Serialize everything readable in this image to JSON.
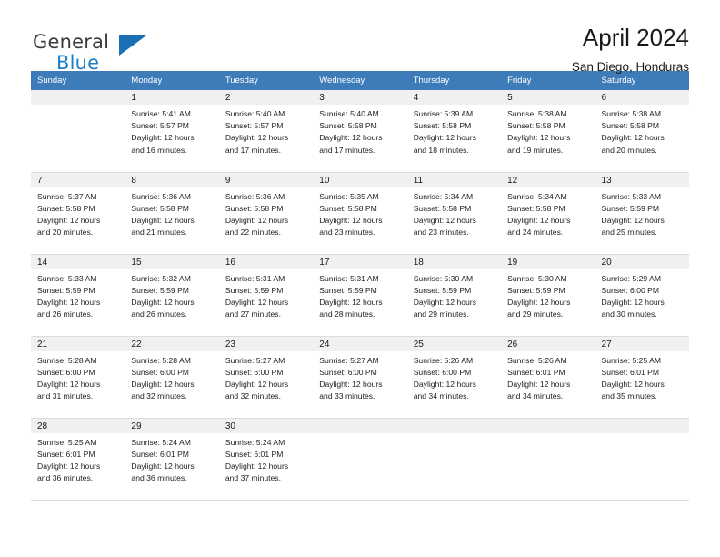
{
  "brand": {
    "word1": "General",
    "word2": "Blue",
    "triangle_color": "#1b6fb4",
    "blue_color": "#1b7fc4"
  },
  "header": {
    "title": "April 2024",
    "location": "San Diego, Honduras"
  },
  "theme": {
    "header_row_bg": "#3d7cb9",
    "daynum_bg": "#f0f0f0",
    "grid_line": "#dcdcdc"
  },
  "weekdays": [
    "Sunday",
    "Monday",
    "Tuesday",
    "Wednesday",
    "Thursday",
    "Friday",
    "Saturday"
  ],
  "labels": {
    "sunrise": "Sunrise:",
    "sunset": "Sunset:",
    "daylight": "Daylight:"
  },
  "weeks": [
    [
      {
        "day": ""
      },
      {
        "day": "1",
        "sunrise": "Sunrise: 5:41 AM",
        "sunset": "Sunset: 5:57 PM",
        "daylight1": "Daylight: 12 hours",
        "daylight2": "and 16 minutes."
      },
      {
        "day": "2",
        "sunrise": "Sunrise: 5:40 AM",
        "sunset": "Sunset: 5:57 PM",
        "daylight1": "Daylight: 12 hours",
        "daylight2": "and 17 minutes."
      },
      {
        "day": "3",
        "sunrise": "Sunrise: 5:40 AM",
        "sunset": "Sunset: 5:58 PM",
        "daylight1": "Daylight: 12 hours",
        "daylight2": "and 17 minutes."
      },
      {
        "day": "4",
        "sunrise": "Sunrise: 5:39 AM",
        "sunset": "Sunset: 5:58 PM",
        "daylight1": "Daylight: 12 hours",
        "daylight2": "and 18 minutes."
      },
      {
        "day": "5",
        "sunrise": "Sunrise: 5:38 AM",
        "sunset": "Sunset: 5:58 PM",
        "daylight1": "Daylight: 12 hours",
        "daylight2": "and 19 minutes."
      },
      {
        "day": "6",
        "sunrise": "Sunrise: 5:38 AM",
        "sunset": "Sunset: 5:58 PM",
        "daylight1": "Daylight: 12 hours",
        "daylight2": "and 20 minutes."
      }
    ],
    [
      {
        "day": "7",
        "sunrise": "Sunrise: 5:37 AM",
        "sunset": "Sunset: 5:58 PM",
        "daylight1": "Daylight: 12 hours",
        "daylight2": "and 20 minutes."
      },
      {
        "day": "8",
        "sunrise": "Sunrise: 5:36 AM",
        "sunset": "Sunset: 5:58 PM",
        "daylight1": "Daylight: 12 hours",
        "daylight2": "and 21 minutes."
      },
      {
        "day": "9",
        "sunrise": "Sunrise: 5:36 AM",
        "sunset": "Sunset: 5:58 PM",
        "daylight1": "Daylight: 12 hours",
        "daylight2": "and 22 minutes."
      },
      {
        "day": "10",
        "sunrise": "Sunrise: 5:35 AM",
        "sunset": "Sunset: 5:58 PM",
        "daylight1": "Daylight: 12 hours",
        "daylight2": "and 23 minutes."
      },
      {
        "day": "11",
        "sunrise": "Sunrise: 5:34 AM",
        "sunset": "Sunset: 5:58 PM",
        "daylight1": "Daylight: 12 hours",
        "daylight2": "and 23 minutes."
      },
      {
        "day": "12",
        "sunrise": "Sunrise: 5:34 AM",
        "sunset": "Sunset: 5:58 PM",
        "daylight1": "Daylight: 12 hours",
        "daylight2": "and 24 minutes."
      },
      {
        "day": "13",
        "sunrise": "Sunrise: 5:33 AM",
        "sunset": "Sunset: 5:59 PM",
        "daylight1": "Daylight: 12 hours",
        "daylight2": "and 25 minutes."
      }
    ],
    [
      {
        "day": "14",
        "sunrise": "Sunrise: 5:33 AM",
        "sunset": "Sunset: 5:59 PM",
        "daylight1": "Daylight: 12 hours",
        "daylight2": "and 26 minutes."
      },
      {
        "day": "15",
        "sunrise": "Sunrise: 5:32 AM",
        "sunset": "Sunset: 5:59 PM",
        "daylight1": "Daylight: 12 hours",
        "daylight2": "and 26 minutes."
      },
      {
        "day": "16",
        "sunrise": "Sunrise: 5:31 AM",
        "sunset": "Sunset: 5:59 PM",
        "daylight1": "Daylight: 12 hours",
        "daylight2": "and 27 minutes."
      },
      {
        "day": "17",
        "sunrise": "Sunrise: 5:31 AM",
        "sunset": "Sunset: 5:59 PM",
        "daylight1": "Daylight: 12 hours",
        "daylight2": "and 28 minutes."
      },
      {
        "day": "18",
        "sunrise": "Sunrise: 5:30 AM",
        "sunset": "Sunset: 5:59 PM",
        "daylight1": "Daylight: 12 hours",
        "daylight2": "and 29 minutes."
      },
      {
        "day": "19",
        "sunrise": "Sunrise: 5:30 AM",
        "sunset": "Sunset: 5:59 PM",
        "daylight1": "Daylight: 12 hours",
        "daylight2": "and 29 minutes."
      },
      {
        "day": "20",
        "sunrise": "Sunrise: 5:29 AM",
        "sunset": "Sunset: 6:00 PM",
        "daylight1": "Daylight: 12 hours",
        "daylight2": "and 30 minutes."
      }
    ],
    [
      {
        "day": "21",
        "sunrise": "Sunrise: 5:28 AM",
        "sunset": "Sunset: 6:00 PM",
        "daylight1": "Daylight: 12 hours",
        "daylight2": "and 31 minutes."
      },
      {
        "day": "22",
        "sunrise": "Sunrise: 5:28 AM",
        "sunset": "Sunset: 6:00 PM",
        "daylight1": "Daylight: 12 hours",
        "daylight2": "and 32 minutes."
      },
      {
        "day": "23",
        "sunrise": "Sunrise: 5:27 AM",
        "sunset": "Sunset: 6:00 PM",
        "daylight1": "Daylight: 12 hours",
        "daylight2": "and 32 minutes."
      },
      {
        "day": "24",
        "sunrise": "Sunrise: 5:27 AM",
        "sunset": "Sunset: 6:00 PM",
        "daylight1": "Daylight: 12 hours",
        "daylight2": "and 33 minutes."
      },
      {
        "day": "25",
        "sunrise": "Sunrise: 5:26 AM",
        "sunset": "Sunset: 6:00 PM",
        "daylight1": "Daylight: 12 hours",
        "daylight2": "and 34 minutes."
      },
      {
        "day": "26",
        "sunrise": "Sunrise: 5:26 AM",
        "sunset": "Sunset: 6:01 PM",
        "daylight1": "Daylight: 12 hours",
        "daylight2": "and 34 minutes."
      },
      {
        "day": "27",
        "sunrise": "Sunrise: 5:25 AM",
        "sunset": "Sunset: 6:01 PM",
        "daylight1": "Daylight: 12 hours",
        "daylight2": "and 35 minutes."
      }
    ],
    [
      {
        "day": "28",
        "sunrise": "Sunrise: 5:25 AM",
        "sunset": "Sunset: 6:01 PM",
        "daylight1": "Daylight: 12 hours",
        "daylight2": "and 36 minutes."
      },
      {
        "day": "29",
        "sunrise": "Sunrise: 5:24 AM",
        "sunset": "Sunset: 6:01 PM",
        "daylight1": "Daylight: 12 hours",
        "daylight2": "and 36 minutes."
      },
      {
        "day": "30",
        "sunrise": "Sunrise: 5:24 AM",
        "sunset": "Sunset: 6:01 PM",
        "daylight1": "Daylight: 12 hours",
        "daylight2": "and 37 minutes."
      },
      {
        "day": ""
      },
      {
        "day": ""
      },
      {
        "day": ""
      },
      {
        "day": ""
      }
    ]
  ]
}
